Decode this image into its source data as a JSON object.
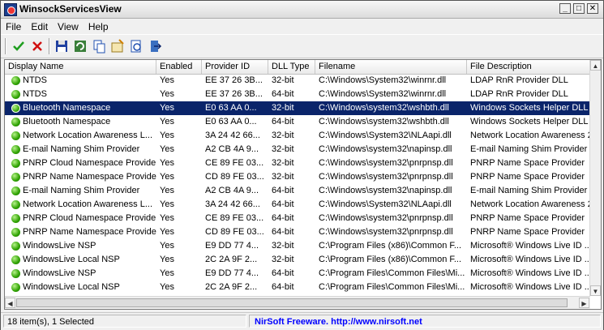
{
  "window": {
    "title": "WinsockServicesView"
  },
  "menu": [
    "File",
    "Edit",
    "View",
    "Help"
  ],
  "columns": [
    "Display Name",
    "Enabled",
    "Provider ID",
    "DLL Type",
    "Filename",
    "File Description"
  ],
  "rows": [
    {
      "name": "NTDS",
      "enabled": "Yes",
      "provider": "EE 37 26 3B...",
      "dll": "32-bit",
      "file": "C:\\Windows\\System32\\winrnr.dll",
      "desc": "LDAP RnR Provider DLL"
    },
    {
      "name": "NTDS",
      "enabled": "Yes",
      "provider": "EE 37 26 3B...",
      "dll": "64-bit",
      "file": "C:\\Windows\\System32\\winrnr.dll",
      "desc": "LDAP RnR Provider DLL"
    },
    {
      "name": "Bluetooth Namespace",
      "enabled": "Yes",
      "provider": "E0 63 AA 0...",
      "dll": "32-bit",
      "file": "C:\\Windows\\system32\\wshbth.dll",
      "desc": "Windows Sockets Helper DLL"
    },
    {
      "name": "Bluetooth Namespace",
      "enabled": "Yes",
      "provider": "E0 63 AA 0...",
      "dll": "64-bit",
      "file": "C:\\Windows\\system32\\wshbth.dll",
      "desc": "Windows Sockets Helper DLL"
    },
    {
      "name": "Network Location Awareness L...",
      "enabled": "Yes",
      "provider": "3A 24 42 66...",
      "dll": "32-bit",
      "file": "C:\\Windows\\System32\\NLAapi.dll",
      "desc": "Network Location Awareness 2"
    },
    {
      "name": "E-mail Naming Shim Provider",
      "enabled": "Yes",
      "provider": "A2 CB 4A 9...",
      "dll": "32-bit",
      "file": "C:\\Windows\\system32\\napinsp.dll",
      "desc": "E-mail Naming Shim Provider"
    },
    {
      "name": "PNRP Cloud Namespace Provider",
      "enabled": "Yes",
      "provider": "CE 89 FE 03...",
      "dll": "32-bit",
      "file": "C:\\Windows\\system32\\pnrpnsp.dll",
      "desc": "PNRP Name Space Provider"
    },
    {
      "name": "PNRP Name Namespace Provider",
      "enabled": "Yes",
      "provider": "CD 89 FE 03...",
      "dll": "32-bit",
      "file": "C:\\Windows\\system32\\pnrpnsp.dll",
      "desc": "PNRP Name Space Provider"
    },
    {
      "name": "E-mail Naming Shim Provider",
      "enabled": "Yes",
      "provider": "A2 CB 4A 9...",
      "dll": "64-bit",
      "file": "C:\\Windows\\system32\\napinsp.dll",
      "desc": "E-mail Naming Shim Provider"
    },
    {
      "name": "Network Location Awareness L...",
      "enabled": "Yes",
      "provider": "3A 24 42 66...",
      "dll": "64-bit",
      "file": "C:\\Windows\\System32\\NLAapi.dll",
      "desc": "Network Location Awareness 2"
    },
    {
      "name": "PNRP Cloud Namespace Provider",
      "enabled": "Yes",
      "provider": "CE 89 FE 03...",
      "dll": "64-bit",
      "file": "C:\\Windows\\system32\\pnrpnsp.dll",
      "desc": "PNRP Name Space Provider"
    },
    {
      "name": "PNRP Name Namespace Provider",
      "enabled": "Yes",
      "provider": "CD 89 FE 03...",
      "dll": "64-bit",
      "file": "C:\\Windows\\system32\\pnrpnsp.dll",
      "desc": "PNRP Name Space Provider"
    },
    {
      "name": "WindowsLive NSP",
      "enabled": "Yes",
      "provider": "E9 DD 77 4...",
      "dll": "32-bit",
      "file": "C:\\Program Files (x86)\\Common F...",
      "desc": "Microsoft® Windows Live ID ..."
    },
    {
      "name": "WindowsLive Local NSP",
      "enabled": "Yes",
      "provider": "2C 2A 9F 2...",
      "dll": "32-bit",
      "file": "C:\\Program Files (x86)\\Common F...",
      "desc": "Microsoft® Windows Live ID ..."
    },
    {
      "name": "WindowsLive NSP",
      "enabled": "Yes",
      "provider": "E9 DD 77 4...",
      "dll": "64-bit",
      "file": "C:\\Program Files\\Common Files\\Mi...",
      "desc": "Microsoft® Windows Live ID ..."
    },
    {
      "name": "WindowsLive Local NSP",
      "enabled": "Yes",
      "provider": "2C 2A 9F 2...",
      "dll": "64-bit",
      "file": "C:\\Program Files\\Common Files\\Mi...",
      "desc": "Microsoft® Windows Live ID ..."
    }
  ],
  "selected_row": 2,
  "status": {
    "count": "18 item(s), 1 Selected",
    "link": "NirSoft Freeware.  http://www.nirsoft.net"
  }
}
